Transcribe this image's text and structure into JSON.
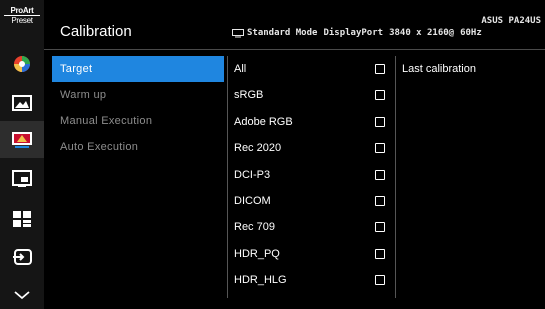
{
  "brand": {
    "logo_line1": "ProArt",
    "logo_line2": "Preset"
  },
  "rail": {
    "items": [
      {
        "icon": "color-wheel-icon"
      },
      {
        "icon": "image-icon"
      },
      {
        "icon": "pip-icon"
      },
      {
        "icon": "system-icon"
      },
      {
        "icon": "input-select-icon"
      },
      {
        "icon": "chevron-down-icon"
      }
    ],
    "active_icon": "calibration-icon"
  },
  "header": {
    "title": "Calibration",
    "mode": "Standard Mode",
    "input": "DisplayPort",
    "resolution": "3840 x 2160@",
    "refresh": "60Hz",
    "model": "ASUS PA24US"
  },
  "submenu": {
    "items": [
      {
        "label": "Target",
        "selected": true
      },
      {
        "label": "Warm up",
        "selected": false
      },
      {
        "label": "Manual Execution",
        "selected": false
      },
      {
        "label": "Auto Execution",
        "selected": false
      }
    ]
  },
  "targets": {
    "items": [
      {
        "label": "All",
        "checked": false
      },
      {
        "label": "sRGB",
        "checked": false
      },
      {
        "label": "Adobe RGB",
        "checked": false
      },
      {
        "label": "Rec 2020",
        "checked": false
      },
      {
        "label": "DCI-P3",
        "checked": false
      },
      {
        "label": "DICOM",
        "checked": false
      },
      {
        "label": "Rec 709",
        "checked": false
      },
      {
        "label": "HDR_PQ",
        "checked": false
      },
      {
        "label": "HDR_HLG",
        "checked": false
      }
    ]
  },
  "info": {
    "last_calibration": "Last calibration"
  },
  "colors": {
    "accent": "#1f86e0",
    "rail_bg": "#151515",
    "muted_text": "#8d8d8d"
  }
}
